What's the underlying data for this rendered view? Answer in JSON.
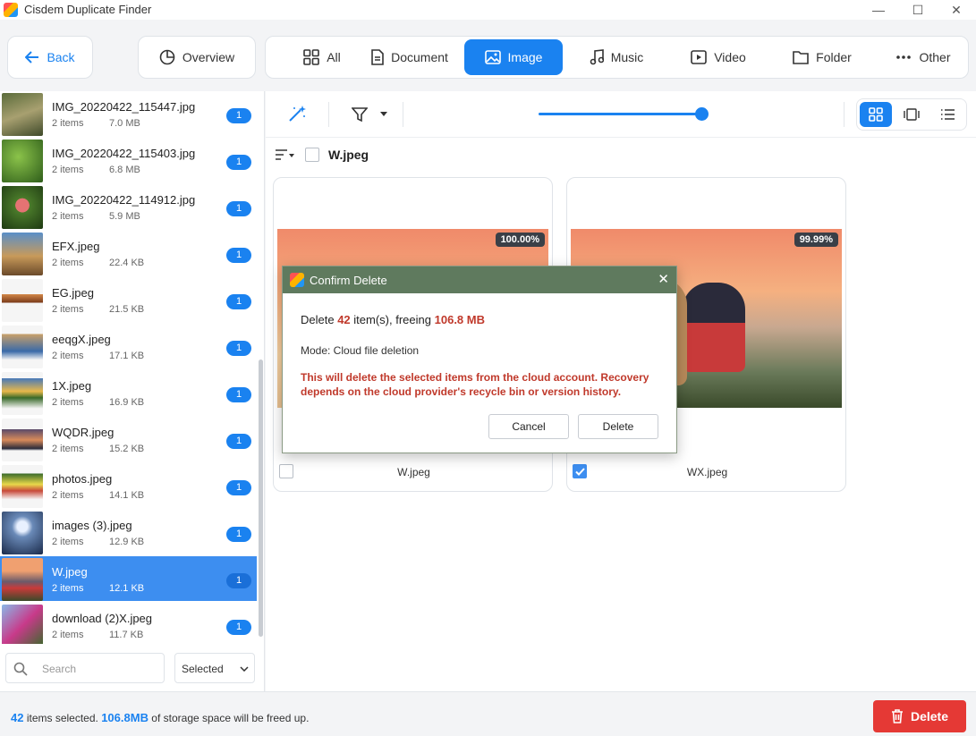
{
  "window": {
    "title": "Cisdem Duplicate Finder",
    "minimize": "—",
    "maximize": "☐",
    "close": "✕"
  },
  "toolbar": {
    "back_label": "Back",
    "overview_label": "Overview"
  },
  "tabs": [
    {
      "label": "All",
      "icon": "grid-icon"
    },
    {
      "label": "Document",
      "icon": "document-icon"
    },
    {
      "label": "Image",
      "icon": "image-icon",
      "active": true
    },
    {
      "label": "Music",
      "icon": "music-icon"
    },
    {
      "label": "Video",
      "icon": "video-icon"
    },
    {
      "label": "Folder",
      "icon": "folder-icon"
    },
    {
      "label": "Other",
      "icon": "more-icon"
    }
  ],
  "sidebar": {
    "items": [
      {
        "name": "IMG_20220422_115447.jpg",
        "count": "2 items",
        "size": "7.0 MB",
        "badge": "1"
      },
      {
        "name": "IMG_20220422_115403.jpg",
        "count": "2 items",
        "size": "6.8 MB",
        "badge": "1"
      },
      {
        "name": "IMG_20220422_114912.jpg",
        "count": "2 items",
        "size": "5.9 MB",
        "badge": "1"
      },
      {
        "name": "EFX.jpeg",
        "count": "2 items",
        "size": "22.4 KB",
        "badge": "1"
      },
      {
        "name": "EG.jpeg",
        "count": "2 items",
        "size": "21.5 KB",
        "badge": "1"
      },
      {
        "name": "eeqgX.jpeg",
        "count": "2 items",
        "size": "17.1 KB",
        "badge": "1"
      },
      {
        "name": "1X.jpeg",
        "count": "2 items",
        "size": "16.9 KB",
        "badge": "1"
      },
      {
        "name": "WQDR.jpeg",
        "count": "2 items",
        "size": "15.2 KB",
        "badge": "1"
      },
      {
        "name": "photos.jpeg",
        "count": "2 items",
        "size": "14.1 KB",
        "badge": "1"
      },
      {
        "name": "images (3).jpeg",
        "count": "2 items",
        "size": "12.9 KB",
        "badge": "1"
      },
      {
        "name": "W.jpeg",
        "count": "2 items",
        "size": "12.1 KB",
        "badge": "1",
        "selected": true
      },
      {
        "name": "download (2)X.jpeg",
        "count": "2 items",
        "size": "11.7 KB",
        "badge": "1"
      }
    ],
    "search_placeholder": "Search",
    "filter_value": "Selected"
  },
  "main": {
    "group_name": "W.jpeg",
    "cards": [
      {
        "name": "W.jpeg",
        "similarity": "100.00%",
        "checked": false
      },
      {
        "name": "WX.jpeg",
        "similarity": "99.99%",
        "checked": true
      }
    ],
    "slider_level": 1.0
  },
  "dialog": {
    "title": "Confirm Delete",
    "line1_prefix": "Delete",
    "count": "42",
    "line1_mid": "item(s), freeing",
    "size": "106.8 MB",
    "mode": "Mode: Cloud file deletion",
    "warning": "This will delete the selected items from the cloud account. Recovery depends on the cloud provider's recycle bin or version history.",
    "cancel_label": "Cancel",
    "delete_label": "Delete"
  },
  "status": {
    "count": "42",
    "count_suffix": "items selected.",
    "size": "106.8MB",
    "size_suffix": "of storage space will be freed up.",
    "delete_label": "Delete"
  },
  "colors": {
    "accent": "#1a82f0",
    "danger": "#e53935",
    "dialog_title": "#5f7a5e"
  }
}
